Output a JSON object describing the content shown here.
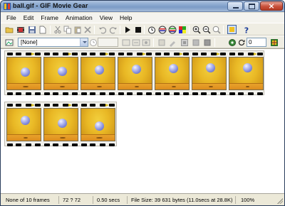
{
  "window": {
    "title": "ball.gif - GIF Movie Gear"
  },
  "menu": [
    "File",
    "Edit",
    "Frame",
    "Animation",
    "View",
    "Help"
  ],
  "toolbar1_icons": [
    "open-icon",
    "movie-icon",
    "save-icon",
    "new-icon",
    "cut-icon",
    "copy-icon",
    "paste-icon",
    "delete-icon",
    "undo-icon",
    "redo-icon",
    "play-icon",
    "stop-icon",
    "timer-icon",
    "palette-icon",
    "palette2-icon",
    "colors-icon",
    "zoom-in-icon",
    "zoom-out-icon",
    "zoom-fit-icon",
    "preview-icon",
    "help-icon"
  ],
  "toolbar2": {
    "transparency_select": "[None]",
    "frame_value": "",
    "delay_value": "0"
  },
  "frames": {
    "count": 10,
    "ball_heights": [
      0.55,
      0.6,
      0.66,
      0.72,
      0.77,
      0.8,
      0.82,
      0.72,
      0.55,
      0.35
    ]
  },
  "status": {
    "selection": "None of 10 frames",
    "dimensions": "72 ? 72",
    "duration": "0.50 secs",
    "file_size": "File Size: 39 631 bytes  (11.0secs at 28.8K)",
    "zoom": "100%"
  },
  "colors": {
    "title_gradient": "#8aa8cf",
    "window_bg": "#ece9d8",
    "frame_yellow": "#e9b825",
    "ball_blue": "#7e87d9"
  }
}
